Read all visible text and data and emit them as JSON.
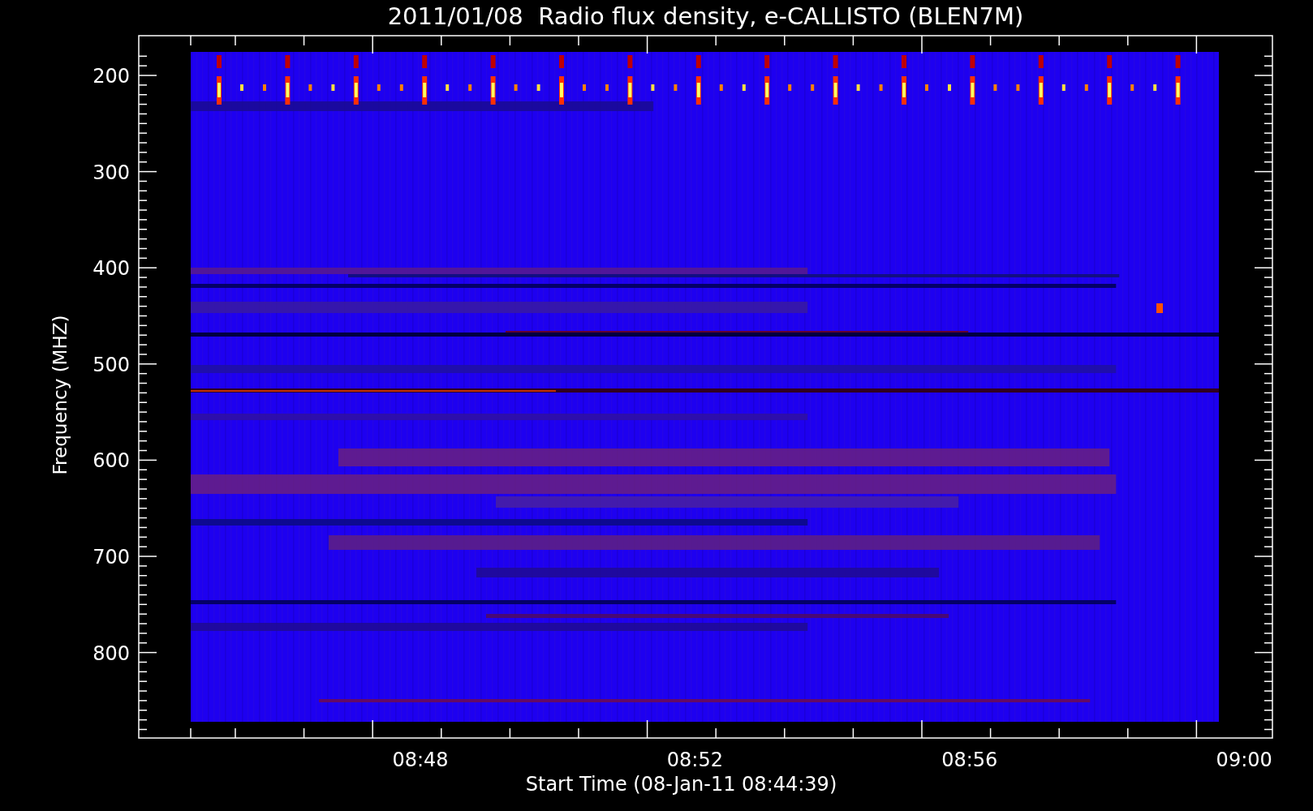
{
  "title": "2011/01/08  Radio flux density, e-CALLISTO (BLEN7M)",
  "y_axis": {
    "label": "Frequency (MHZ)",
    "ticks": [
      "200",
      "300",
      "400",
      "500",
      "600",
      "700",
      "800"
    ]
  },
  "x_axis": {
    "label": "Start Time (08-Jan-11 08:44:39)",
    "ticks": [
      "08:48",
      "08:52",
      "08:56",
      "09:00"
    ]
  }
}
